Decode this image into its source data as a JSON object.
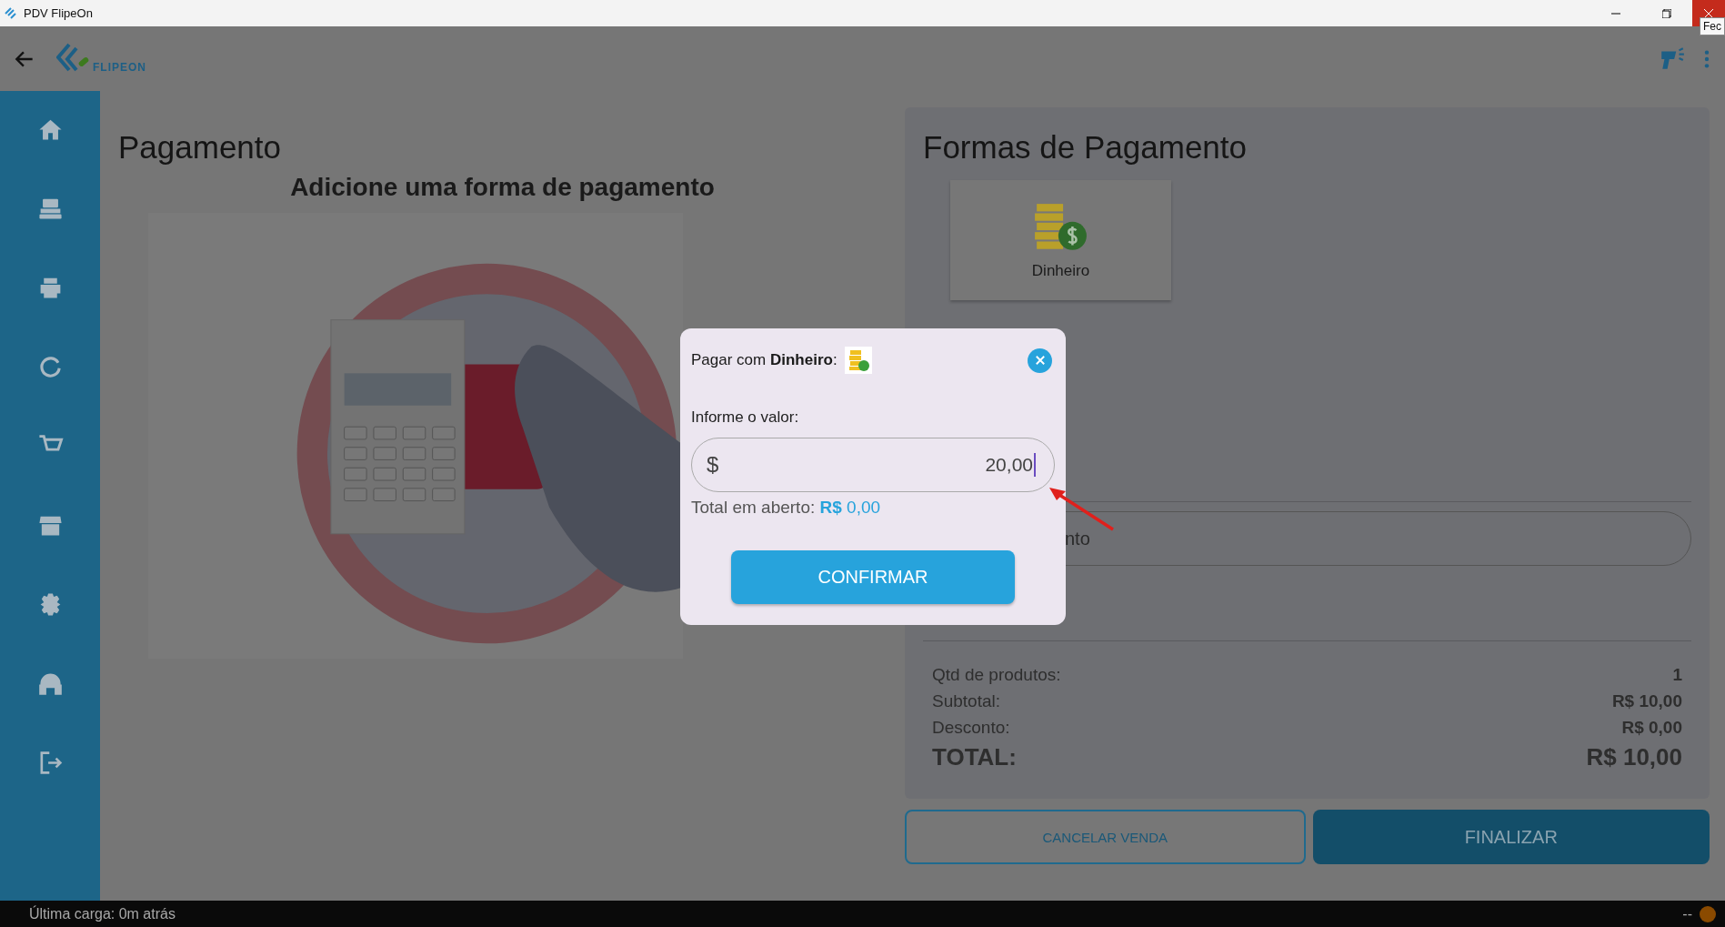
{
  "window": {
    "title": "PDV FlipeOn",
    "close_tooltip": "Fec"
  },
  "app_bar": {
    "logo_text": "FLIPEON"
  },
  "payment": {
    "title": "Pagamento",
    "subtitle": "Adicione uma forma de pagamento"
  },
  "payment_methods": {
    "title": "Formas de Pagamento",
    "methods": [
      {
        "label": "Dinheiro",
        "selected": false
      }
    ]
  },
  "discount_field": {
    "visible_text": "nto"
  },
  "summary": {
    "rows": [
      {
        "label": "Qtd de produtos:",
        "value": "1",
        "kind": "normal"
      },
      {
        "label": "Subtotal:",
        "value": "R$ 10,00",
        "kind": "normal"
      },
      {
        "label": "Desconto:",
        "value": "R$ 0,00",
        "kind": "normal"
      },
      {
        "label": "TOTAL:",
        "value": "R$ 10,00",
        "kind": "total"
      }
    ]
  },
  "actions": {
    "cancel": "CANCELAR VENDA",
    "finish": "FINALIZAR"
  },
  "dialog": {
    "title": "Pagar com **Dinheiro**:",
    "input_label": "Informe o valor:",
    "currency": "$",
    "value": "20,00",
    "open_total_label": "Total em aberto:",
    "open_total_value": "**R$** 0,00",
    "confirm": "CONFIRMAR"
  },
  "status_bar": {
    "text": "Última carga: 0m atrás",
    "indicator": "--"
  }
}
